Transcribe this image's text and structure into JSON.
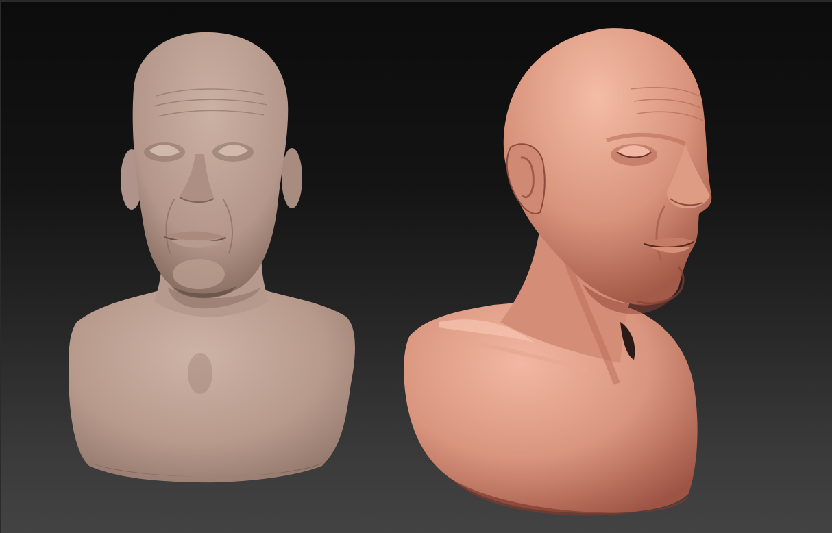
{
  "app": {
    "window_type": "3d-sculpt-viewport"
  },
  "viewport": {
    "background_top": "#0c0c0c",
    "background_bottom": "#434343"
  },
  "models": [
    {
      "name": "bust-front-view",
      "material_color": "#b89a8c",
      "view": "front"
    },
    {
      "name": "bust-three-quarter-view",
      "material_color": "#d58f7a",
      "view": "three-quarter-right"
    }
  ]
}
